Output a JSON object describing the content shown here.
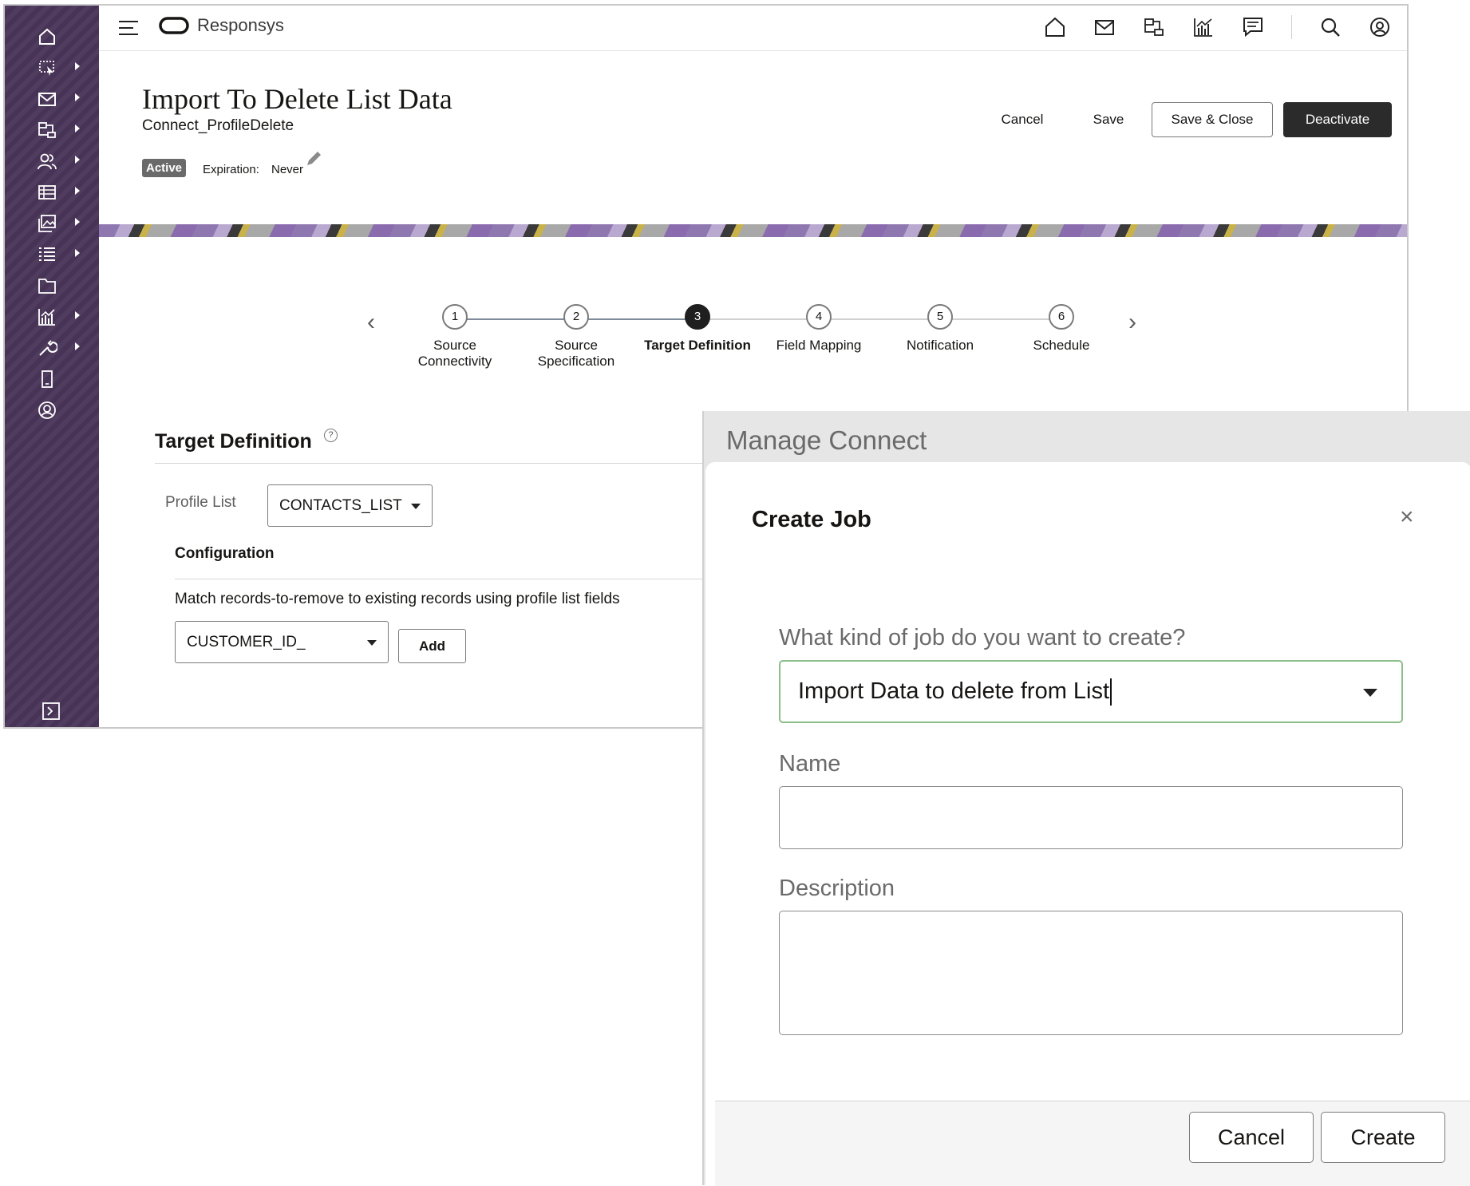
{
  "app": {
    "brand": "Responsys"
  },
  "sidebar": {
    "items": [
      {
        "icon": "home-icon",
        "has_submenu": false
      },
      {
        "icon": "select-cursor-icon",
        "has_submenu": true
      },
      {
        "icon": "mail-icon",
        "has_submenu": true
      },
      {
        "icon": "program-flow-icon",
        "has_submenu": true
      },
      {
        "icon": "audience-icon",
        "has_submenu": true
      },
      {
        "icon": "table-icon",
        "has_submenu": true
      },
      {
        "icon": "image-content-icon",
        "has_submenu": true
      },
      {
        "icon": "list-icon",
        "has_submenu": true
      },
      {
        "icon": "folder-icon",
        "has_submenu": false
      },
      {
        "icon": "analytics-chart-icon",
        "has_submenu": true
      },
      {
        "icon": "wrench-icon",
        "has_submenu": true
      },
      {
        "icon": "mobile-device-icon",
        "has_submenu": false
      },
      {
        "icon": "user-circle-icon",
        "has_submenu": false
      }
    ],
    "bottom_icon": "expand-panel-icon"
  },
  "topbar": {
    "icons": [
      "home-icon",
      "mail-icon",
      "program-flow-icon",
      "analytics-chart-icon",
      "chat-icon",
      "search-icon",
      "user-account-icon"
    ]
  },
  "page": {
    "title": "Import To Delete List Data",
    "subtitle": "Connect_ProfileDelete",
    "status_badge": "Active",
    "expiration_label": "Expiration:",
    "expiration_value": "Never",
    "actions": {
      "cancel": "Cancel",
      "save": "Save",
      "save_close": "Save & Close",
      "deactivate": "Deactivate"
    }
  },
  "train": {
    "current_step": 3,
    "steps": [
      {
        "num": "1",
        "label_line1": "Source",
        "label_line2": "Connectivity"
      },
      {
        "num": "2",
        "label_line1": "Source",
        "label_line2": "Specification"
      },
      {
        "num": "3",
        "label_line1": "Target Definition",
        "label_line2": ""
      },
      {
        "num": "4",
        "label_line1": "Field Mapping",
        "label_line2": ""
      },
      {
        "num": "5",
        "label_line1": "Notification",
        "label_line2": ""
      },
      {
        "num": "6",
        "label_line1": "Schedule",
        "label_line2": ""
      }
    ]
  },
  "target_definition": {
    "title": "Target Definition",
    "help": "?",
    "profile_list_label": "Profile List",
    "profile_list_value": "CONTACTS_LIST",
    "configuration_title": "Configuration",
    "match_text": "Match records-to-remove to existing records using profile list fields",
    "match_field_value": "CUSTOMER_ID_",
    "add_button": "Add"
  },
  "dialog": {
    "outer_title": "Manage Connect",
    "title": "Create Job",
    "close": "×",
    "job_kind_label": "What kind of job do you want to create?",
    "job_kind_value": "Import Data to delete from List",
    "name_label": "Name",
    "name_value": "",
    "description_label": "Description",
    "description_value": "",
    "cancel": "Cancel",
    "create": "Create"
  }
}
